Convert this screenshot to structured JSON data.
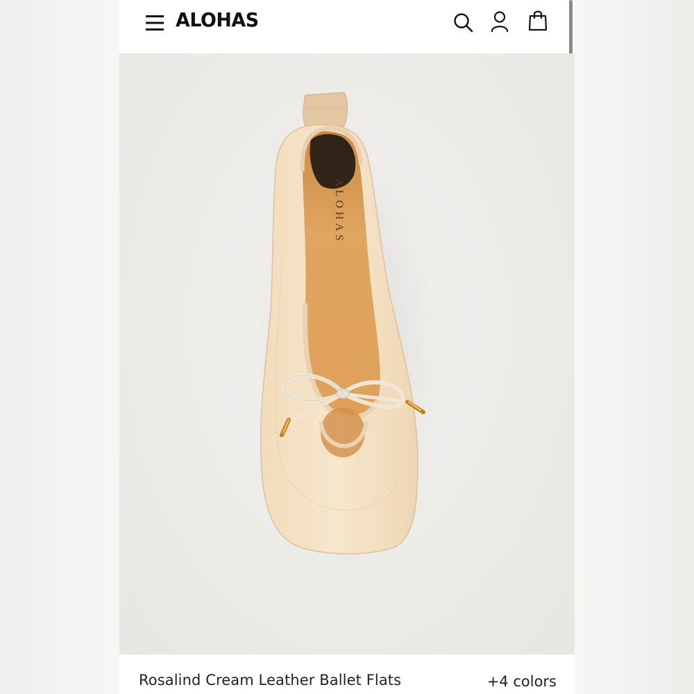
{
  "header": {
    "logo": "ALOHAS",
    "icons": [
      "menu-icon",
      "search-icon",
      "account-icon",
      "shopping-bag-icon"
    ]
  },
  "hero": {
    "insole_brand": "ALOHAS"
  },
  "product": {
    "name": "Rosalind Cream Leather Ballet Flats",
    "colors": "+4 colors"
  }
}
